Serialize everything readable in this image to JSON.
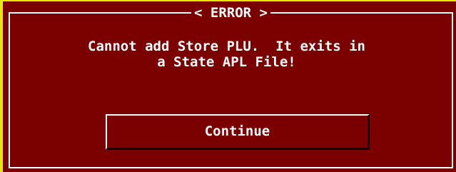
{
  "dialog": {
    "title": "< ERROR >",
    "message_line1": "Cannot add Store PLU.  It exits in",
    "message_line2": "a State APL File!",
    "button_label": "Continue"
  },
  "colors": {
    "background": "#7b0000",
    "text": "#ffffff",
    "outer_border": "#e8e800"
  }
}
